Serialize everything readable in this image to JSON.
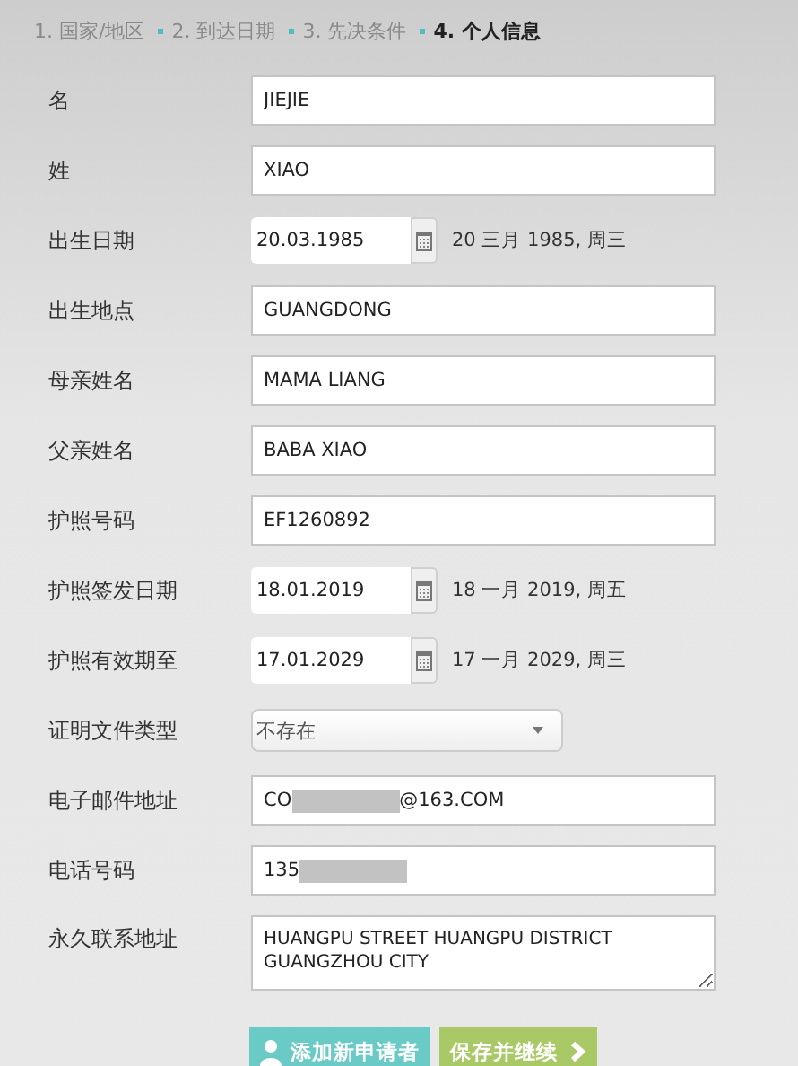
{
  "steps": [
    {
      "label": "1. 国家/地区",
      "selected": false
    },
    {
      "label": "2. 到达日期",
      "selected": false
    },
    {
      "label": "3. 先决条件",
      "selected": false
    },
    {
      "label": "4. 个人信息",
      "selected": true
    }
  ],
  "fields": [
    {
      "kind": "text",
      "label": "名",
      "value": "JIEJIE"
    },
    {
      "kind": "text",
      "label": "姓",
      "value": "XIAO"
    },
    {
      "kind": "date",
      "label": "出生日期",
      "value": "20.03.1985",
      "reading": "20 三月 1985, 周三"
    },
    {
      "kind": "text",
      "label": "出生地点",
      "value": "GUANGDONG"
    },
    {
      "kind": "text",
      "label": "母亲姓名",
      "value": "MAMA LIANG"
    },
    {
      "kind": "text",
      "label": "父亲姓名",
      "value": "BABA XIAO"
    },
    {
      "kind": "text",
      "label": "护照号码",
      "value": "EF1260892"
    },
    {
      "kind": "date",
      "label": "护照签发日期",
      "value": "18.01.2019",
      "reading": "18 一月 2019, 周五"
    },
    {
      "kind": "date",
      "label": "护照有效期至",
      "value": "17.01.2029",
      "reading": "17 一月 2029, 周三"
    },
    {
      "kind": "select",
      "label": "证明文件类型",
      "value": "不存在"
    },
    {
      "kind": "redacted",
      "label": "电子邮件地址",
      "prefix": "CO",
      "suffix": "@163.COM"
    },
    {
      "kind": "redacted",
      "label": "电话号码",
      "prefix": "135"
    },
    {
      "kind": "textarea",
      "label": "永久联系地址",
      "value": "HUANGPU STREET HUANGPU DISTRICT GUANGZHOU CITY"
    }
  ],
  "buttons": [
    {
      "kind": "add",
      "label": "添加新申请者"
    },
    {
      "kind": "next",
      "label": "保存并继续"
    }
  ]
}
